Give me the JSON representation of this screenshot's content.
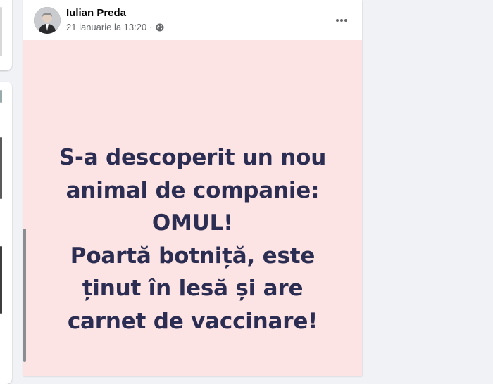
{
  "post": {
    "author": "Iulian Preda",
    "timestamp": "21 ianuarie la 13:20",
    "separator": "·",
    "privacy_icon": "globe-icon",
    "more_icon": "more-options-icon",
    "image_text": {
      "lines": [
        "S-a descoperit un nou",
        "animal de companie:",
        "OMUL!",
        "Poartă botniță, este",
        "ținut în lesă și are",
        "carnet de vaccinare!"
      ]
    }
  },
  "colors": {
    "page_background": "#f0f2f5",
    "image_background": "#fce4e4",
    "image_text": "#2c2d52",
    "secondary_text": "#65676b"
  }
}
